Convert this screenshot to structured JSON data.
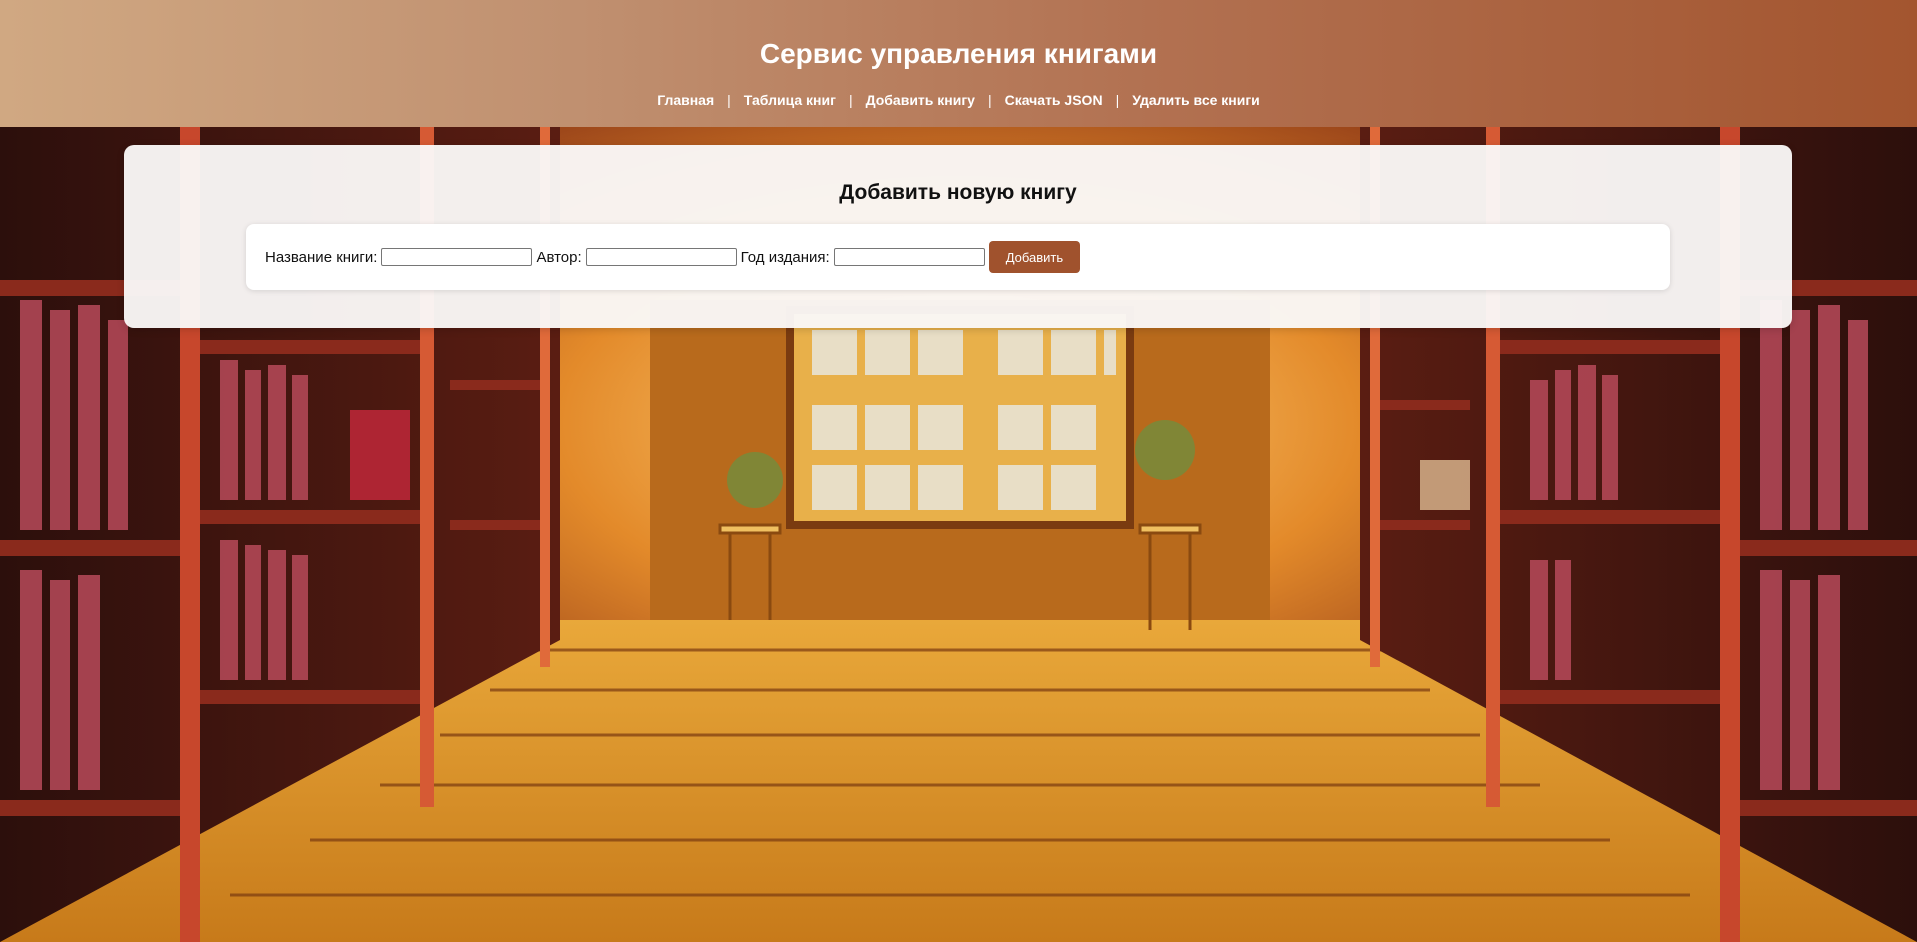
{
  "header": {
    "title": "Сервис управления книгами",
    "nav": [
      {
        "label": "Главная"
      },
      {
        "label": "Таблица книг"
      },
      {
        "label": "Добавить книгу"
      },
      {
        "label": "Скачать JSON"
      },
      {
        "label": "Удалить все книги"
      }
    ],
    "separator": "|"
  },
  "card": {
    "title": "Добавить новую книгу",
    "form": {
      "title_label": "Название книги:",
      "title_value": "",
      "author_label": "Автор:",
      "author_value": "",
      "year_label": "Год издания:",
      "year_value": "",
      "submit_label": "Добавить"
    }
  },
  "colors": {
    "header_start": "#d0a882",
    "header_end": "#a3552f",
    "button": "#a0522d"
  }
}
